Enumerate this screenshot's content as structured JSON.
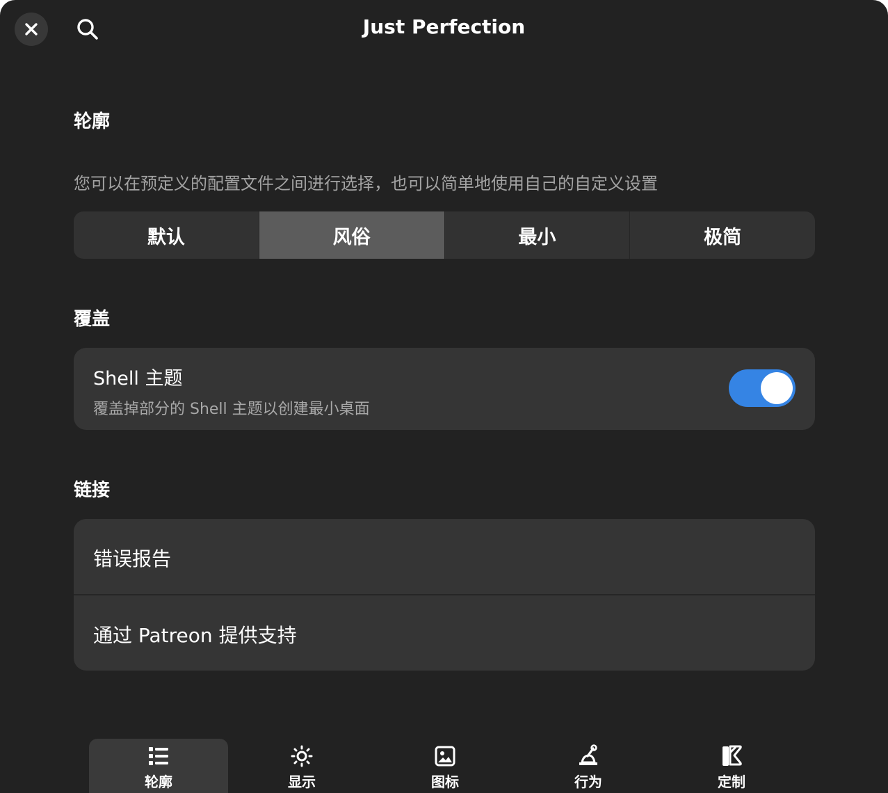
{
  "window": {
    "title": "Just Perfection"
  },
  "header": {
    "close_icon": "close-icon",
    "search_icon": "search-icon"
  },
  "profile": {
    "heading": "轮廓",
    "description": "您可以在预定义的配置文件之间进行选择，也可以简单地使用自己的自定义设置",
    "options": [
      {
        "label": "默认",
        "selected": false
      },
      {
        "label": "风俗",
        "selected": true
      },
      {
        "label": "最小",
        "selected": false
      },
      {
        "label": "极简",
        "selected": false
      }
    ]
  },
  "override": {
    "heading": "覆盖",
    "shell_theme": {
      "title": "Shell 主题",
      "subtitle": "覆盖掉部分的 Shell 主题以创建最小桌面",
      "enabled": true
    }
  },
  "links": {
    "heading": "链接",
    "items": [
      {
        "label": "错误报告"
      },
      {
        "label": "通过 Patreon 提供支持"
      }
    ]
  },
  "bottom_nav": {
    "items": [
      {
        "label": "轮廓",
        "icon": "list-icon",
        "active": true
      },
      {
        "label": "显示",
        "icon": "brightness-icon",
        "active": false
      },
      {
        "label": "图标",
        "icon": "image-icon",
        "active": false
      },
      {
        "label": "行为",
        "icon": "behavior-icon",
        "active": false
      },
      {
        "label": "定制",
        "icon": "customize-icon",
        "active": false
      }
    ]
  },
  "colors": {
    "background": "#222222",
    "card": "#353535",
    "accent": "#3584e4",
    "selected_segment": "#5c5c5c"
  }
}
